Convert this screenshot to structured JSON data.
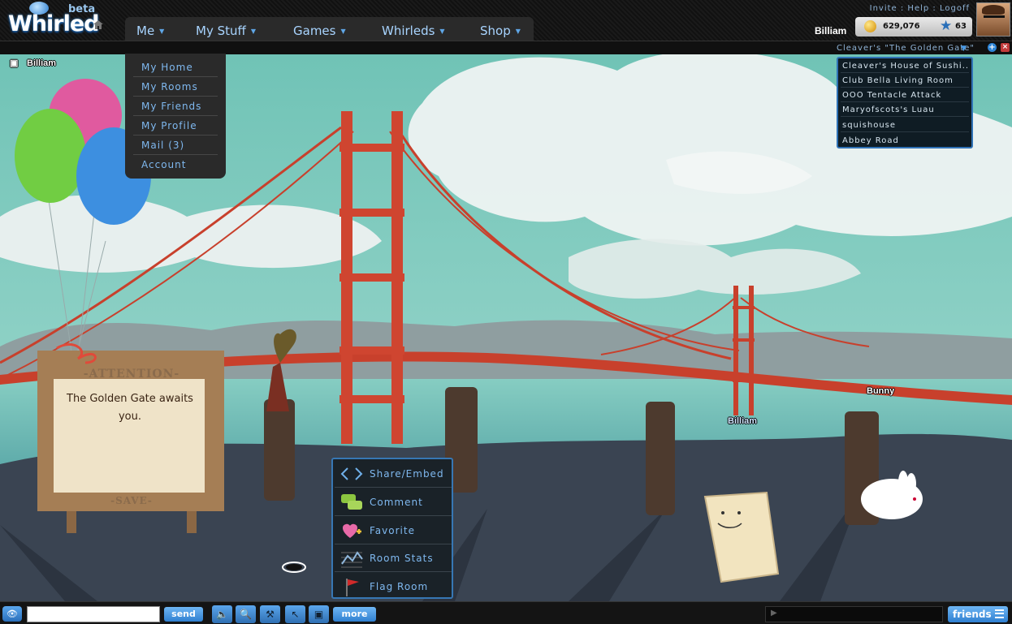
{
  "app": {
    "logo_word": "Whirled",
    "logo_badge": "beta"
  },
  "nav": {
    "items": [
      {
        "label": "Me"
      },
      {
        "label": "My Stuff"
      },
      {
        "label": "Games"
      },
      {
        "label": "Whirleds"
      },
      {
        "label": "Shop"
      }
    ]
  },
  "toplinks": {
    "invite": "Invite",
    "sep": " : ",
    "help": "Help",
    "logoff": "Logoff"
  },
  "user": {
    "name": "Billiam",
    "coins": "629,076",
    "level": "63"
  },
  "room": {
    "title": "Cleaver's \"The Golden Gate\""
  },
  "me_menu": {
    "items": [
      "My Home",
      "My Rooms",
      "My Friends",
      "My Profile",
      "Mail (3)",
      "Account"
    ]
  },
  "room_list": {
    "items": [
      "Cleaver's House of Sushi...",
      "Club Bella Living Room",
      "OOO Tentacle Attack",
      "Maryofscots's Luau",
      "squishouse",
      "Abbey Road"
    ]
  },
  "scene": {
    "corner_name": "Billiam",
    "sign_heading": "-ATTENTION-",
    "sign_text": "The Golden Gate awaits you.",
    "sign_footer": "-SAVE-",
    "avatar_name_bridge": "Billiam",
    "avatar_name_bunny": "Bunny"
  },
  "share_menu": {
    "items": [
      "Share/Embed",
      "Comment",
      "Favorite",
      "Room Stats",
      "Flag Room"
    ]
  },
  "bottombar": {
    "chat_value": "",
    "send_label": "send",
    "more_label": "more",
    "friends_label": "friends"
  },
  "colors": {
    "accent": "#2f7fd0",
    "menu_text": "#7fb8ef",
    "sky": "#7ec9bd",
    "bridge": "#d2462f"
  }
}
